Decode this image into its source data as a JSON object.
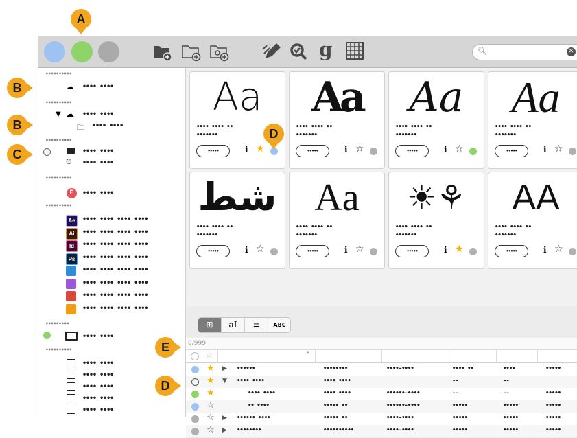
{
  "callouts": [
    "A",
    "B",
    "B",
    "C",
    "D",
    "E",
    "D"
  ],
  "toolbar": {
    "traffic_colors": [
      "#9ec3f2",
      "#8ed469",
      "#aaaaaa"
    ],
    "search_placeholder": "",
    "search_icon": "search-icon",
    "icons": [
      "new-library-icon",
      "new-folder-icon",
      "new-smart-folder-icon",
      "edit-pencil-icon",
      "zoom-magnify-icon",
      "google-fonts-icon",
      "glyph-grid-icon"
    ]
  },
  "sidebar": {
    "sections": [
      {
        "title": "••••••••••"
      },
      {
        "title": "••••••••••"
      },
      {
        "title": "••••••••••"
      },
      {
        "title": "••••••••••"
      },
      {
        "title": "••••••••••"
      },
      {
        "title": "•••••••••"
      },
      {
        "title": "••••••••••"
      }
    ],
    "items": {
      "cloud1": "•••• ••••",
      "cloud2": "•••• ••••",
      "subfolder": "•••• ••••",
      "folder": "•••• ••••",
      "recent": "•••• ••••",
      "fontbase": "•••• ••••",
      "computer": "•••• ••••",
      "apps": [
        {
          "icon": "Ae",
          "label": "•••• •••• •••• ••••",
          "color": "#1f1155"
        },
        {
          "icon": "Ai",
          "label": "•••• •••• •••• ••••",
          "color": "#3a1806"
        },
        {
          "icon": "Id",
          "label": "•••• •••• •••• ••••",
          "color": "#43092a"
        },
        {
          "icon": "Ps",
          "label": "•••• •••• •••• ••••",
          "color": "#0c1f3c"
        },
        {
          "icon": "",
          "label": "•••• •••• •••• ••••",
          "color": "#2f8cd7"
        },
        {
          "icon": "",
          "label": "•••• •••• •••• ••••",
          "color": "#9b58d8"
        },
        {
          "icon": "",
          "label": "•••• •••• •••• ••••",
          "color": "#d9483b"
        },
        {
          "icon": "",
          "label": "•••• •••• •••• ••••",
          "color": "#f39c12"
        }
      ],
      "docs": [
        "•••• ••••",
        "•••• ••••",
        "•••• ••••",
        "•••• ••••",
        "•••• ••••"
      ]
    }
  },
  "grid": {
    "cards": [
      {
        "preview": "Aa",
        "name": "•••• •••• ••",
        "style": "•••••••",
        "pill": "•••••",
        "star": "filled",
        "dot": "#9ec3f2"
      },
      {
        "preview": "Aa",
        "name": "•••• •••• ••",
        "style": "•••••••",
        "pill": "•••••",
        "star": "empty",
        "dot": "#b0b0b0"
      },
      {
        "preview": "Aa",
        "name": "•••• •••• ••",
        "style": "•••••••",
        "pill": "•••••",
        "star": "empty",
        "dot": "#8ed469"
      },
      {
        "preview": "Aa",
        "name": "•••• •••• ••",
        "style": "•••••••",
        "pill": "•••••",
        "star": "empty",
        "dot": "#b0b0b0"
      },
      {
        "preview": "شط",
        "name": "•••• •••• ••",
        "style": "•••••••",
        "pill": "•••••",
        "star": "empty",
        "dot": "#b0b0b0"
      },
      {
        "preview": "Aa",
        "name": "•••• •••• ••",
        "style": "•••••••",
        "pill": "•••••",
        "star": "empty",
        "dot": "#b0b0b0"
      },
      {
        "preview": "☀⚘",
        "name": "•••• •••• ••",
        "style": "•••••••",
        "pill": "•••••",
        "star": "filled",
        "dot": "#b0b0b0"
      },
      {
        "preview": "AA",
        "name": "•••• •••• ••",
        "style": "•••••••",
        "pill": "•••••",
        "star": "empty",
        "dot": "#b0b0b0"
      }
    ],
    "info_label": "i"
  },
  "viewbar": {
    "buttons": [
      "⊞",
      "aI",
      "≡",
      "ABC"
    ]
  },
  "list": {
    "count": "0/999",
    "rows": [
      {
        "dot": "#9ec3f2",
        "star": "filled",
        "expand": "▶",
        "cols": [
          "••••••",
          "••••••••",
          "••••-••••",
          "•••• ••",
          "••••",
          "•••••"
        ]
      },
      {
        "dot": "outline",
        "star": "filled",
        "expand": "▼",
        "cols": [
          "•••• ••••",
          "•••• ••••",
          "",
          "--",
          "--",
          ""
        ]
      },
      {
        "dot": "#8ed469",
        "star": "filled",
        "expand": "",
        "cols": [
          "•••• ••••",
          "•••• ••••",
          "••••••-••••",
          "--",
          "--",
          "•••••"
        ]
      },
      {
        "dot": "#9ec3f2",
        "star": "empty",
        "expand": "",
        "cols": [
          "•• ••••",
          "••••• ••",
          "••••••-••••",
          "•••••",
          "•••••",
          "•••••"
        ]
      },
      {
        "dot": "#b0b0b0",
        "star": "empty",
        "expand": "▶",
        "cols": [
          "•••••• ••••",
          "••••• ••",
          "••••-••••",
          "•••••",
          "•••••",
          "•••••"
        ]
      },
      {
        "dot": "#b0b0b0",
        "star": "empty",
        "expand": "▶",
        "cols": [
          "••••••••",
          "••••••••••",
          "••••-••••",
          "•••••",
          "•••••",
          "•••••"
        ]
      }
    ]
  }
}
